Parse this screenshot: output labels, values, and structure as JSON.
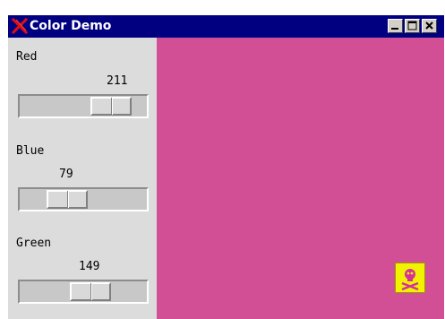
{
  "window": {
    "title": "Color Demo",
    "icon": "x-logo-icon",
    "controls": [
      "minimize-icon",
      "maximize-icon",
      "close-icon"
    ]
  },
  "sliders": [
    {
      "label": "Red",
      "value": "211",
      "level": 211,
      "max": 255
    },
    {
      "label": "Blue",
      "value": "79",
      "level": 79,
      "max": 255
    },
    {
      "label": "Green",
      "value": "149",
      "level": 149,
      "max": 255
    }
  ],
  "swatch": {
    "color": "#d34f95"
  },
  "colors": {
    "titlebar": "#000080",
    "panel": "#dcdcdc",
    "badge": "#f2f200",
    "badge_icon": "#d4329a"
  },
  "badge": {
    "icon": "skull-crossbones-icon"
  }
}
